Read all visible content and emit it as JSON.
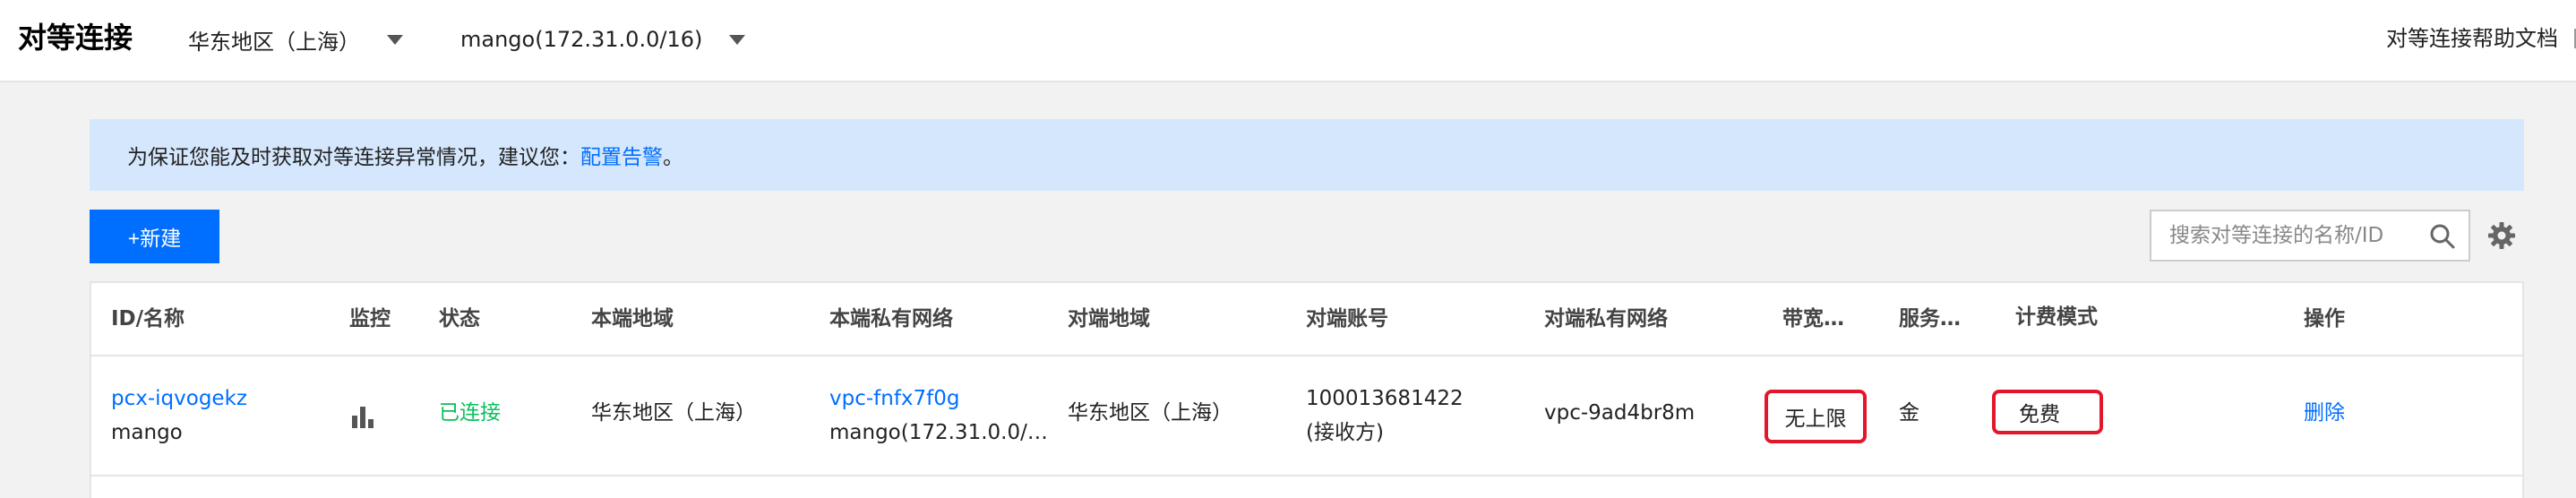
{
  "header": {
    "title": "对等连接",
    "region_select": "华东地区（上海）",
    "vpc_select": "mango(172.31.0.0/16)",
    "help_link": "对等连接帮助文档"
  },
  "alert": {
    "text": "为保证您能及时获取对等连接异常情况，建议您：",
    "link": "配置告警",
    "suffix": "。"
  },
  "toolbar": {
    "new_button": "+新建",
    "search_placeholder": "搜索对等连接的名称/ID"
  },
  "table": {
    "columns": [
      "ID/名称",
      "监控",
      "状态",
      "本端地域",
      "本端私有网络",
      "对端地域",
      "对端账号",
      "对端私有网络",
      "带宽…",
      "服务…",
      "计费模式",
      "操作"
    ],
    "rows": [
      {
        "id": "pcx-iqvogekz",
        "name": "mango",
        "status": "已连接",
        "local_region": "华东地区（上海）",
        "local_vpc_id": "vpc-fnfx7f0g",
        "local_vpc_name": "mango(172.31.0.0/…",
        "peer_region": "华东地区（上海）",
        "peer_account": "100013681422",
        "peer_account_note": "(接收方)",
        "peer_vpc": "vpc-9ad4br8m",
        "bandwidth": "无上限",
        "service": "金",
        "billing": "免费",
        "action": "删除"
      }
    ]
  },
  "icons": [
    "chevron-down-icon",
    "search-icon",
    "gear-icon",
    "bar-chart-icon"
  ],
  "colors": {
    "primary": "#006eff",
    "connected": "#0abf5b",
    "highlight": "#e1182b",
    "alert_bg": "#d5e7fd"
  }
}
